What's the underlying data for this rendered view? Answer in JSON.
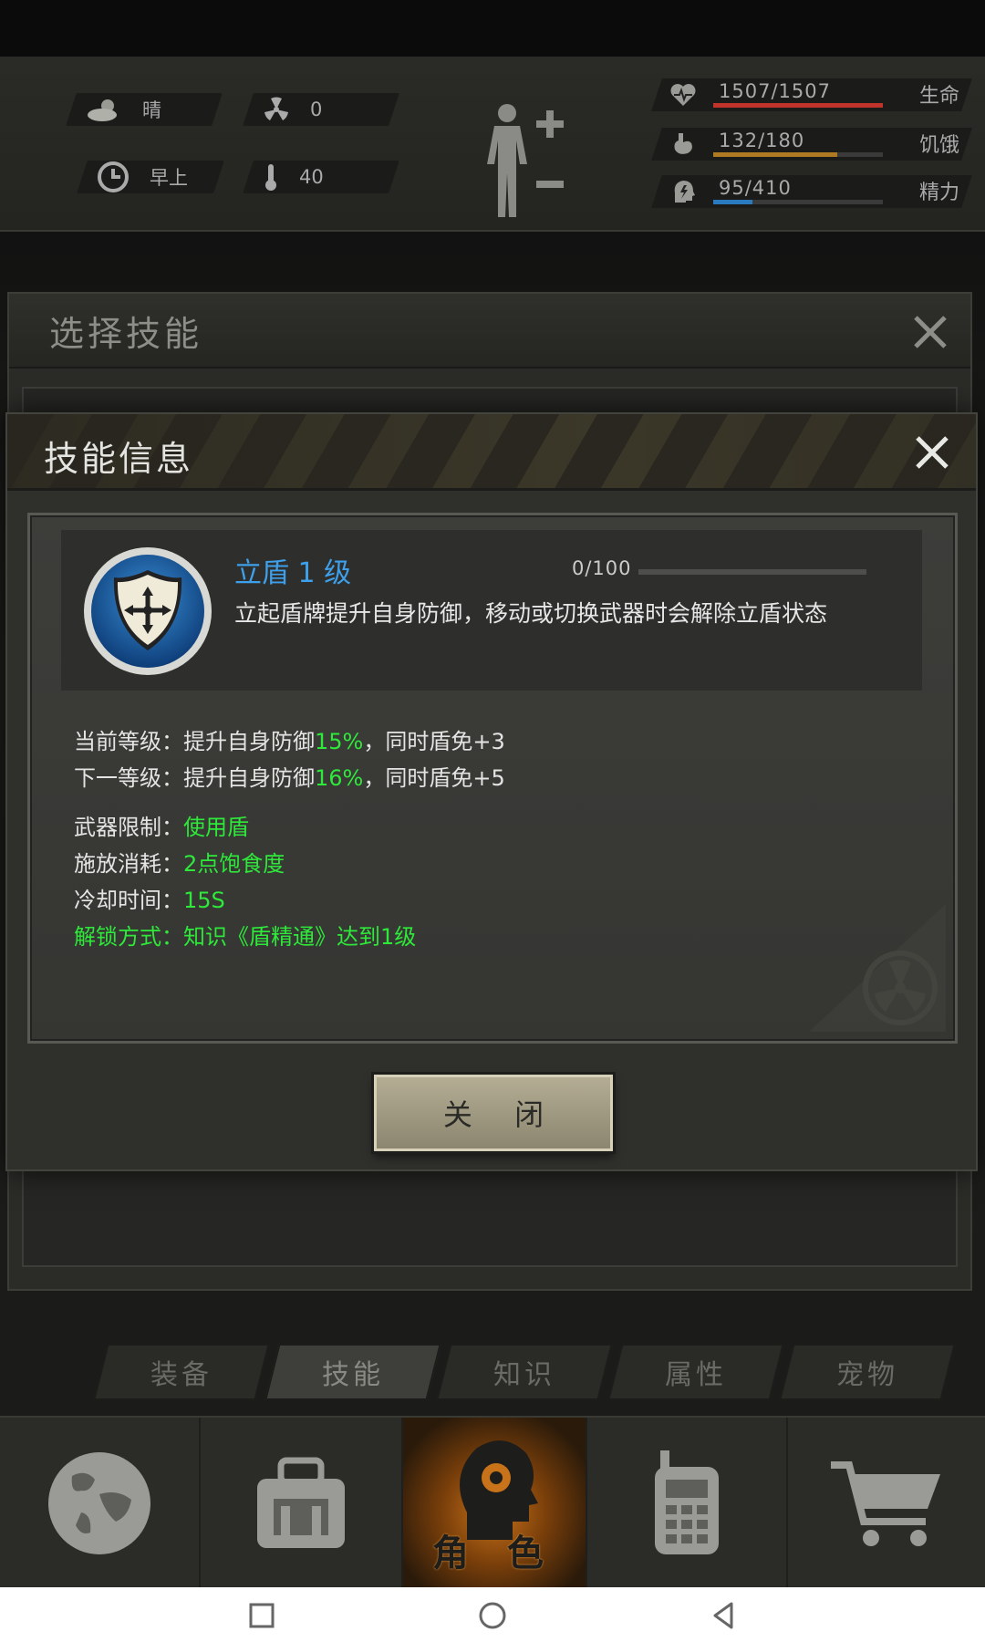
{
  "hud": {
    "weather": "晴",
    "radiation": "0",
    "time_of_day": "早上",
    "temperature": "40",
    "stats": [
      {
        "value": "1507/1507",
        "label": "生命",
        "fraction": 1.0,
        "color": "#c0342c"
      },
      {
        "value": "132/180",
        "label": "饥饿",
        "fraction": 0.733,
        "color": "#b07a22"
      },
      {
        "value": "95/410",
        "label": "精力",
        "fraction": 0.232,
        "color": "#2a7ac0"
      }
    ]
  },
  "select_panel": {
    "title": "选择技能"
  },
  "dialog": {
    "title": "技能信息",
    "skill_name": "立盾 1 级",
    "progress_text": "0/100",
    "progress_fraction": 0,
    "description": "立起盾牌提升自身防御，移动或切换武器时会解除立盾状态",
    "current_level": {
      "label": "当前等级：",
      "prefix": "提升自身防御",
      "value": "15%",
      "suffix": "，同时盾免+3"
    },
    "next_level": {
      "label": "下一等级：",
      "prefix": "提升自身防御",
      "value": "16%",
      "suffix": "，同时盾免+5"
    },
    "weapon_limit": {
      "label": "武器限制：",
      "value": "使用盾"
    },
    "cast_cost": {
      "label": "施放消耗：",
      "value": "2点饱食度"
    },
    "cooldown": {
      "label": "冷却时间：",
      "value": "15S"
    },
    "unlock": {
      "label": "解锁方式：",
      "value": "知识《盾精通》达到1级"
    },
    "close_button": "关 闭"
  },
  "tabs": [
    "装备",
    "技能",
    "知识",
    "属性",
    "宠物"
  ],
  "active_tab": "技能",
  "bottom_nav": {
    "role_label": "角 色"
  }
}
